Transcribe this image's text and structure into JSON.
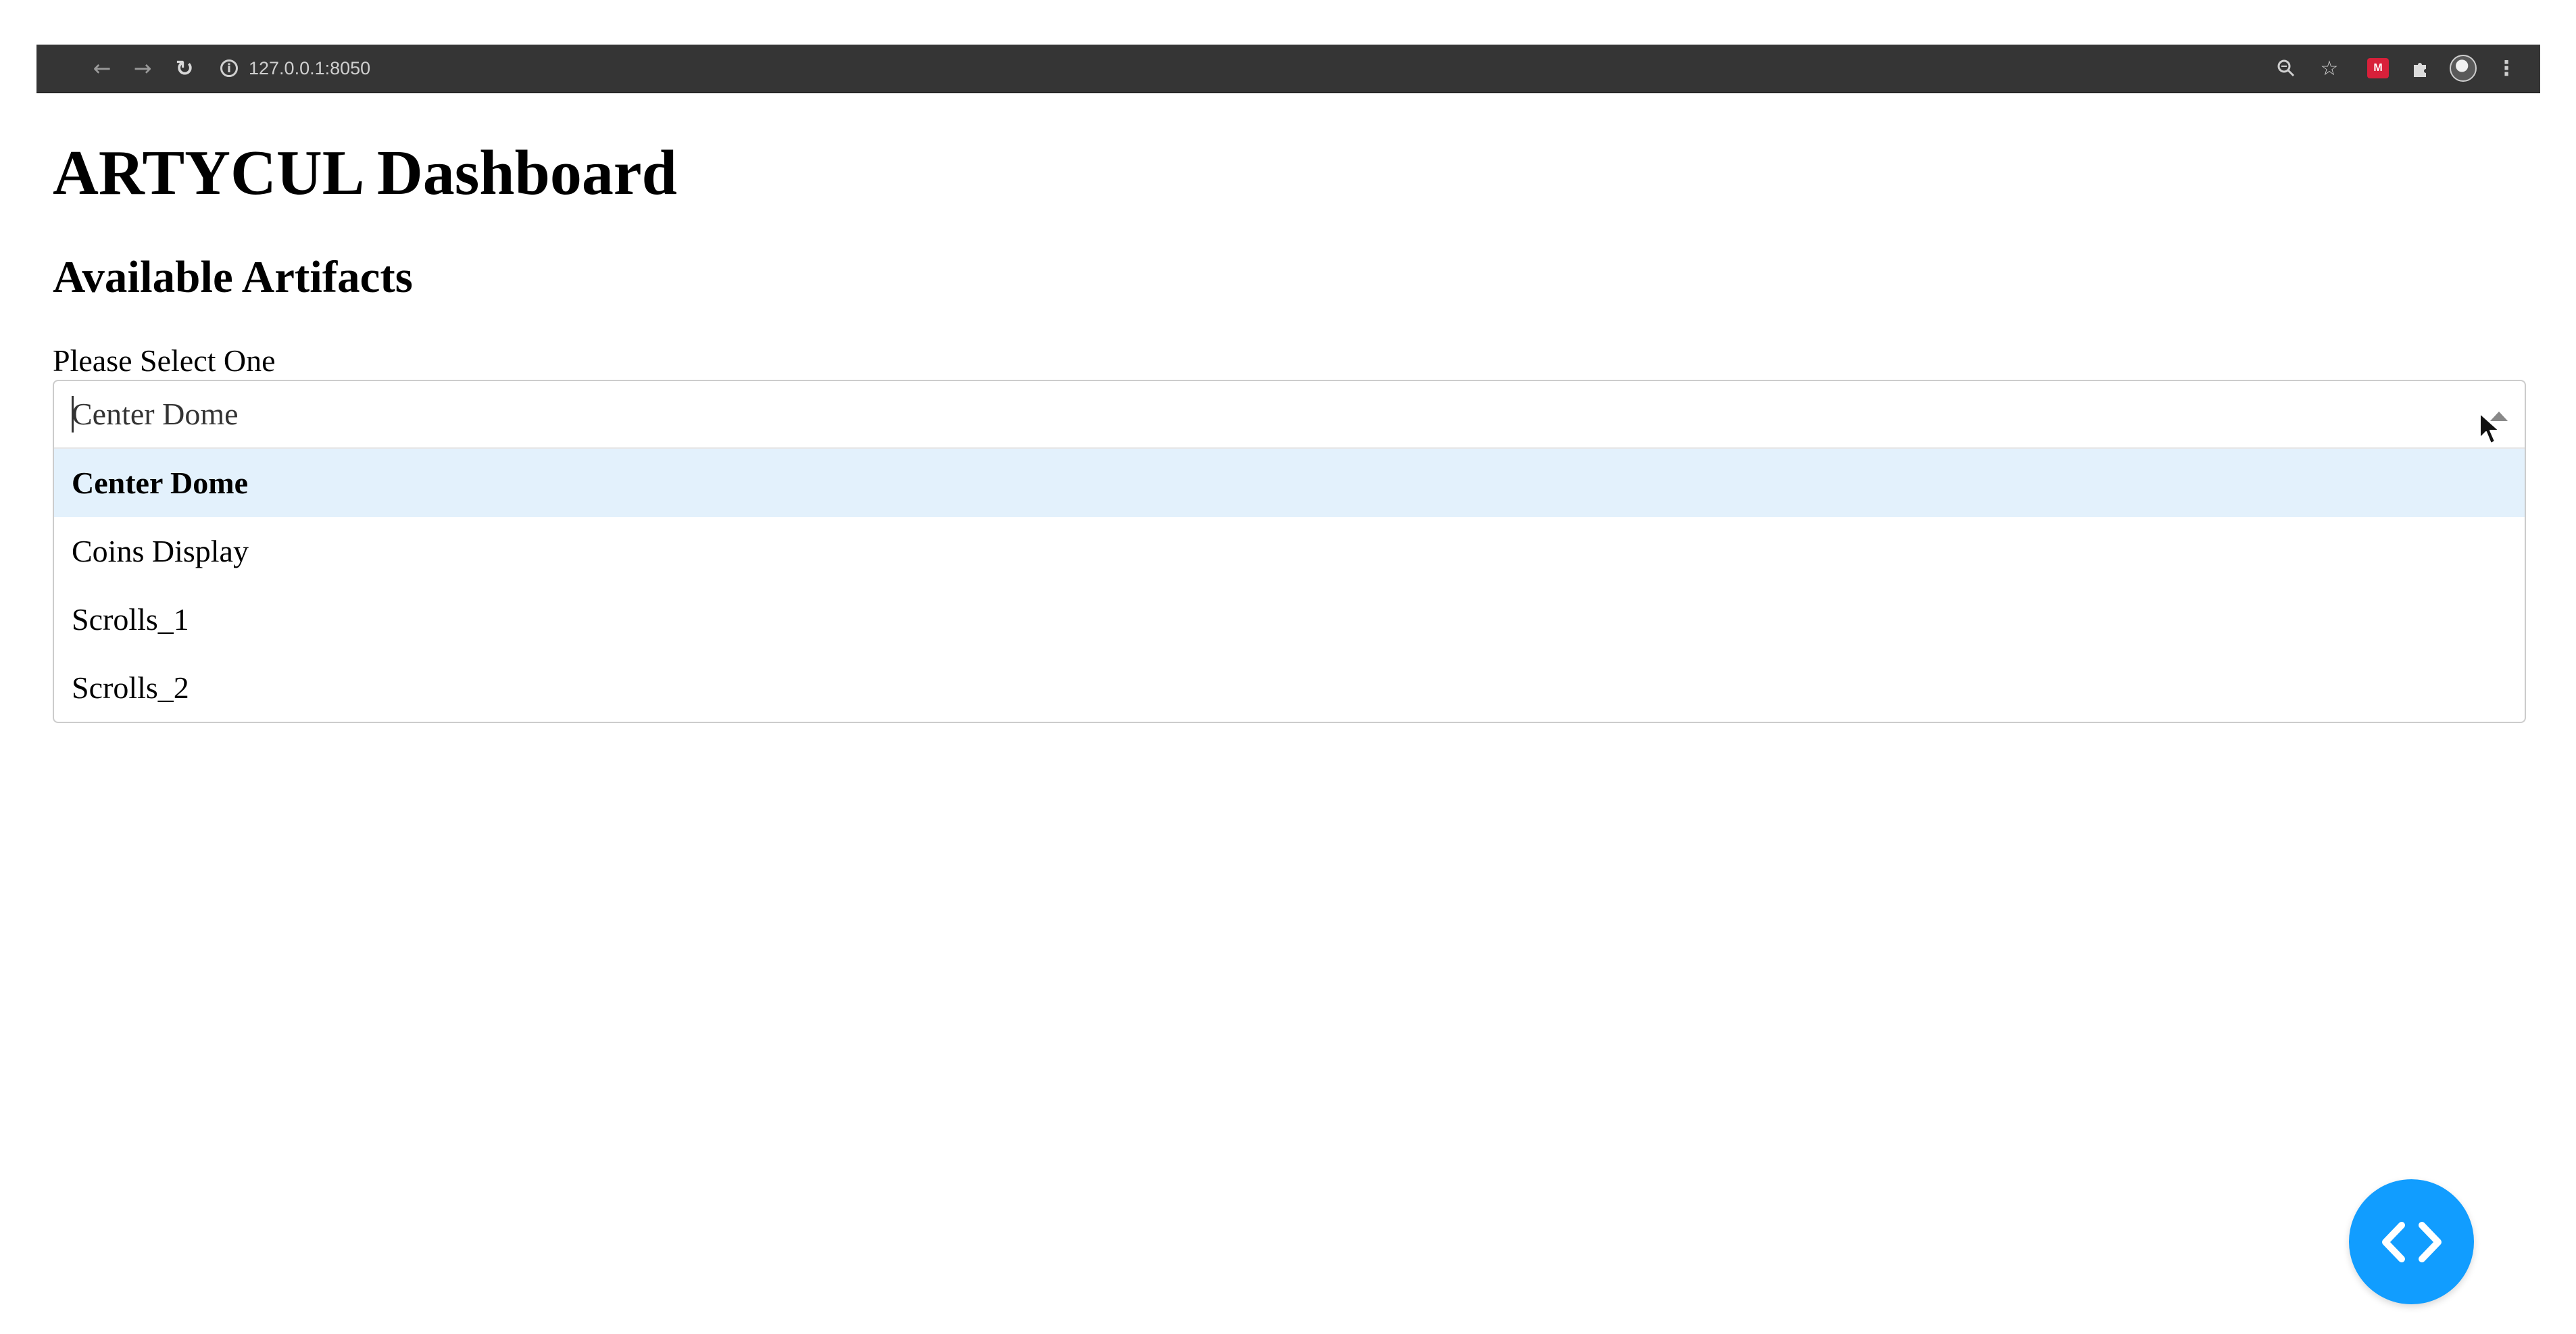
{
  "browser": {
    "url": "127.0.0.1:8050",
    "icons": [
      "back-icon",
      "forward-icon",
      "reload-icon",
      "info-icon",
      "zoom-icon",
      "star-icon",
      "extension-icon",
      "puzzle-icon",
      "profile-icon",
      "menu-icon"
    ]
  },
  "page": {
    "title": "ARTYCUL Dashboard",
    "section_title": "Available Artifacts"
  },
  "dropdown": {
    "label": "Please Select One",
    "value": "Center Dome",
    "options": [
      "Center Dome",
      "Coins Display",
      "Scrolls_1",
      "Scrolls_2"
    ],
    "selected_index": 0
  },
  "colors": {
    "browser_bar": "#353535",
    "option_highlight": "#e3f1fc",
    "fab": "#119dff"
  }
}
